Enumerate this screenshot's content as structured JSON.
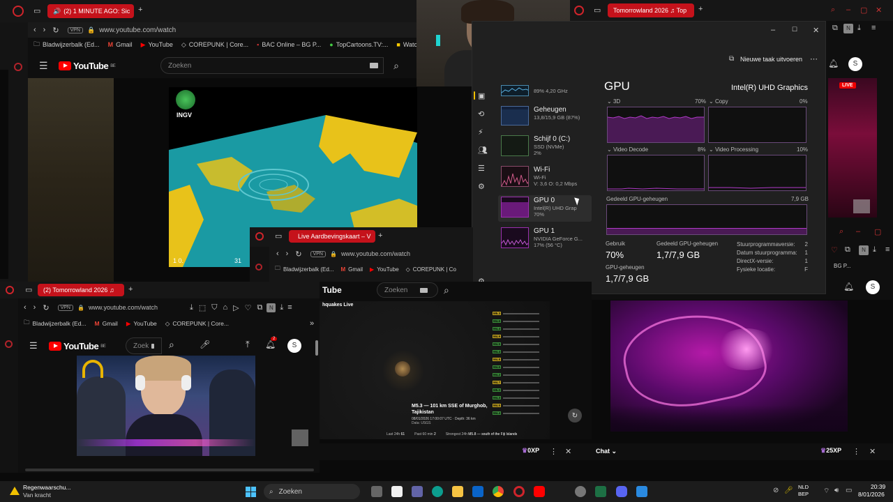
{
  "top_left_browser": {
    "tab_title": "(2) 1 MINUTE AGO: Sic",
    "url": "www.youtube.com/watch",
    "vpn_label": "VPN",
    "bookmarks": [
      "Bladwijzerbalk (Ed...",
      "Gmail",
      "YouTube",
      "COREPUNK | Core...",
      "BAC Online – BG P...",
      "TopCartoons.TV:...",
      "Watc"
    ],
    "yt_region": "BE",
    "search_placeholder": "Zoeken",
    "logo_text": "YouTube",
    "video_overlay_label": "INGV",
    "video_corner_left": "1 0.",
    "video_corner_right": "31"
  },
  "top_right_browser": {
    "tab_title": "Tomorrowland 2026 ♫ Top",
    "live_badge": "LIVE",
    "avatar": "S",
    "bookmark_fragment": "BG P..."
  },
  "task_manager": {
    "new_task_label": "Nieuwe taak uitvoeren",
    "section_title": "GPU",
    "adapter_name": "Intel(R) UHD Graphics",
    "sidebar": [
      {
        "title": "",
        "sub1": "89% 4,20 GHz",
        "sub2": ""
      },
      {
        "title": "Geheugen",
        "sub1": "13,8/15,9 GB (87%)",
        "sub2": ""
      },
      {
        "title": "Schijf 0 (C:)",
        "sub1": "SSD (NVMe)",
        "sub2": "2%"
      },
      {
        "title": "Wi-Fi",
        "sub1": "Wi-Fi",
        "sub2": "V: 3,6 O: 0,2 Mbps"
      },
      {
        "title": "GPU 0",
        "sub1": "Intel(R) UHD Grap",
        "sub2": "70%"
      },
      {
        "title": "GPU 1",
        "sub1": "NVIDIA GeForce G...",
        "sub2": "17% (56 °C)"
      }
    ],
    "graphs": [
      {
        "label": "3D",
        "value": "70%"
      },
      {
        "label": "Copy",
        "value": "0%"
      },
      {
        "label": "Video Decode",
        "value": "8%"
      },
      {
        "label": "Video Processing",
        "value": "10%"
      }
    ],
    "shared_mem_label": "Gedeeld GPU-geheugen",
    "shared_mem_total": "7,9 GB",
    "stats": {
      "usage_label": "Gebruik",
      "usage_value": "70%",
      "shared_label": "Gedeeld GPU-geheugen",
      "shared_value": "1,7/7,9 GB",
      "gpu_mem_label": "GPU-geheugen",
      "gpu_mem_value": "1,7/7,9 GB"
    },
    "driver_info": [
      {
        "label": "Stuurprogrammaversie:",
        "value": "2"
      },
      {
        "label": "Datum stuurprogramma:",
        "value": "1"
      },
      {
        "label": "DirectX-versie:",
        "value": "1"
      },
      {
        "label": "Fysieke locatie:",
        "value": "F"
      }
    ]
  },
  "middle_browser": {
    "tab_title": "Live Aardbevingskaart – V",
    "url": "www.youtube.com/watch",
    "vpn_label": "VPN",
    "bookmarks": [
      "Bladwijzerbalk (Ed...",
      "Gmail",
      "YouTube",
      "COREPUNK | Co"
    ],
    "search_placeholder": "Zoeken",
    "logo_fragment": "Tube",
    "map_title": "hquakes Live",
    "quake_title": "M5.3 — 101 km SSE of Murghob, Tajikistan",
    "quake_sub": "08/01/2026 17:00:07 UTC · Depth: 36 km",
    "quake_source": "Data: USGS",
    "footer_stats": [
      {
        "label": "Last 24h",
        "value": "61"
      },
      {
        "label": "Past 60 min",
        "value": "2"
      },
      {
        "label": "Strongest 24h",
        "value": "M5.8 — south of the Fiji Islands"
      }
    ],
    "quake_list": [
      "M5.3",
      "M4.6",
      "M4.4",
      "M4.9",
      "M4.5",
      "M4.4",
      "M4.8",
      "M4.6",
      "M4.2",
      "M4.7",
      "M5.0",
      "M4.3",
      "M4.5",
      "M4.4"
    ]
  },
  "bottom_left_browser": {
    "tab_title": "(2) Tomorrowland 2026 ♫",
    "url": "www.youtube.com/watch",
    "vpn_label": "VPN",
    "bookmarks": [
      "Bladwijzerbalk (Ed...",
      "Gmail",
      "YouTube",
      "COREPUNK | Core..."
    ],
    "yt_region": "BE",
    "logo_text": "YouTube",
    "search_placeholder": "Zoek",
    "notif_count": "2",
    "avatar": "S"
  },
  "chat_strip": {
    "xp_left": "0XP",
    "chat_label": "Chat",
    "xp_right": "25XP"
  },
  "taskbar": {
    "weather_title": "Regenwaarschu...",
    "weather_sub": "Van kracht",
    "search_label": "Zoeken",
    "lang_line1": "NLD",
    "lang_line2": "BEP",
    "time": "20:39",
    "date": "8/01/2026"
  },
  "colors": {
    "accent_red": "#c5121b",
    "gpu_purple": "#9b2fae",
    "yt_red": "#ff0000"
  }
}
